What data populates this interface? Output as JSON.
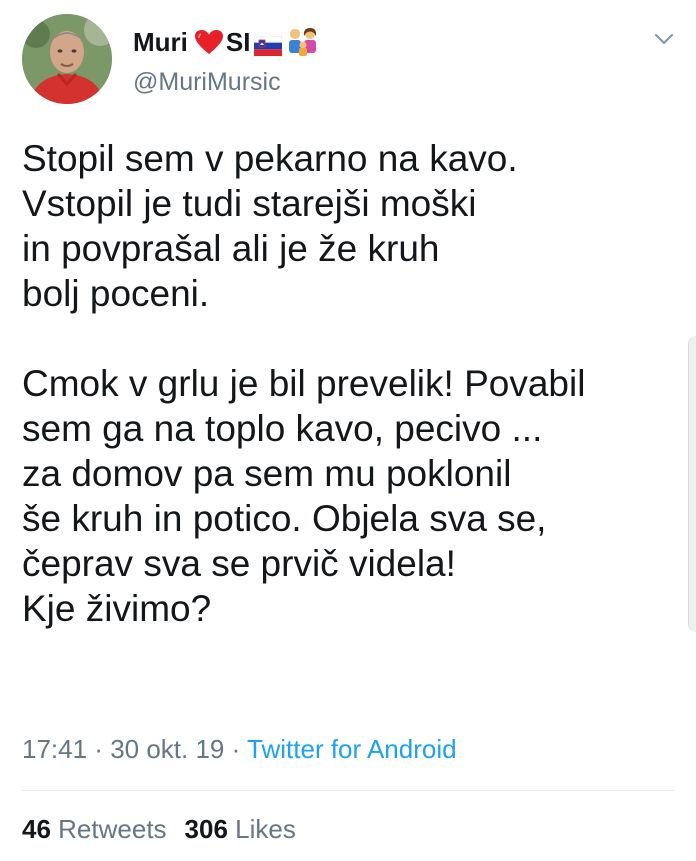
{
  "author": {
    "display_name": "Muri",
    "name_suffix": "SI",
    "handle": "@MuriMursic",
    "name_emojis": [
      "red-heart",
      "slovenia-flag",
      "family"
    ]
  },
  "tweet": {
    "paragraph_1": [
      "Stopil sem v pekarno na kavo.",
      "Vstopil je tudi starejši moški",
      "in povprašal ali je že kruh",
      "bolj poceni."
    ],
    "paragraph_2": [
      "Cmok v grlu je bil prevelik! Povabil",
      "sem ga na toplo kavo, pecivo ...",
      "za domov pa sem mu poklonil",
      "še kruh in potico. Objela sva se,",
      "čeprav sva se prvič videla!",
      "Kje živimo?"
    ]
  },
  "meta": {
    "time": "17:41",
    "separator": " · ",
    "date": "30 okt. 19",
    "source": "Twitter for Android"
  },
  "stats": {
    "retweets_count": "46",
    "retweets_label": "Retweets",
    "likes_count": "306",
    "likes_label": "Likes"
  },
  "colors": {
    "text": "#14171a",
    "secondary": "#657786",
    "link": "#1da1f2",
    "divider": "#e6ecf0"
  }
}
